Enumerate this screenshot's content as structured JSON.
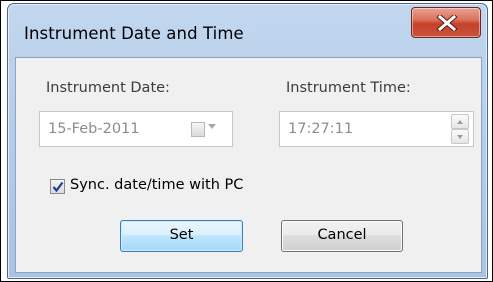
{
  "window": {
    "title": "Instrument Date and Time"
  },
  "date": {
    "label": "Instrument Date:",
    "value": "15-Feb-2011"
  },
  "time": {
    "label": "Instrument Time:",
    "value": "17:27:11"
  },
  "sync": {
    "label": "Sync. date/time with PC",
    "checked": true
  },
  "buttons": {
    "set": "Set",
    "cancel": "Cancel"
  },
  "icons": {
    "close": "close-icon",
    "calendar": "calendar-icon",
    "dropdown": "chevron-down-icon",
    "spin_up": "spin-up-icon",
    "spin_down": "spin-down-icon",
    "checkmark": "checkmark-icon"
  },
  "colors": {
    "close_button": "#c7412a",
    "default_button_border": "#3c7fb1",
    "checkmark": "#1d3f8c",
    "client_background": "#f0f0f0"
  }
}
